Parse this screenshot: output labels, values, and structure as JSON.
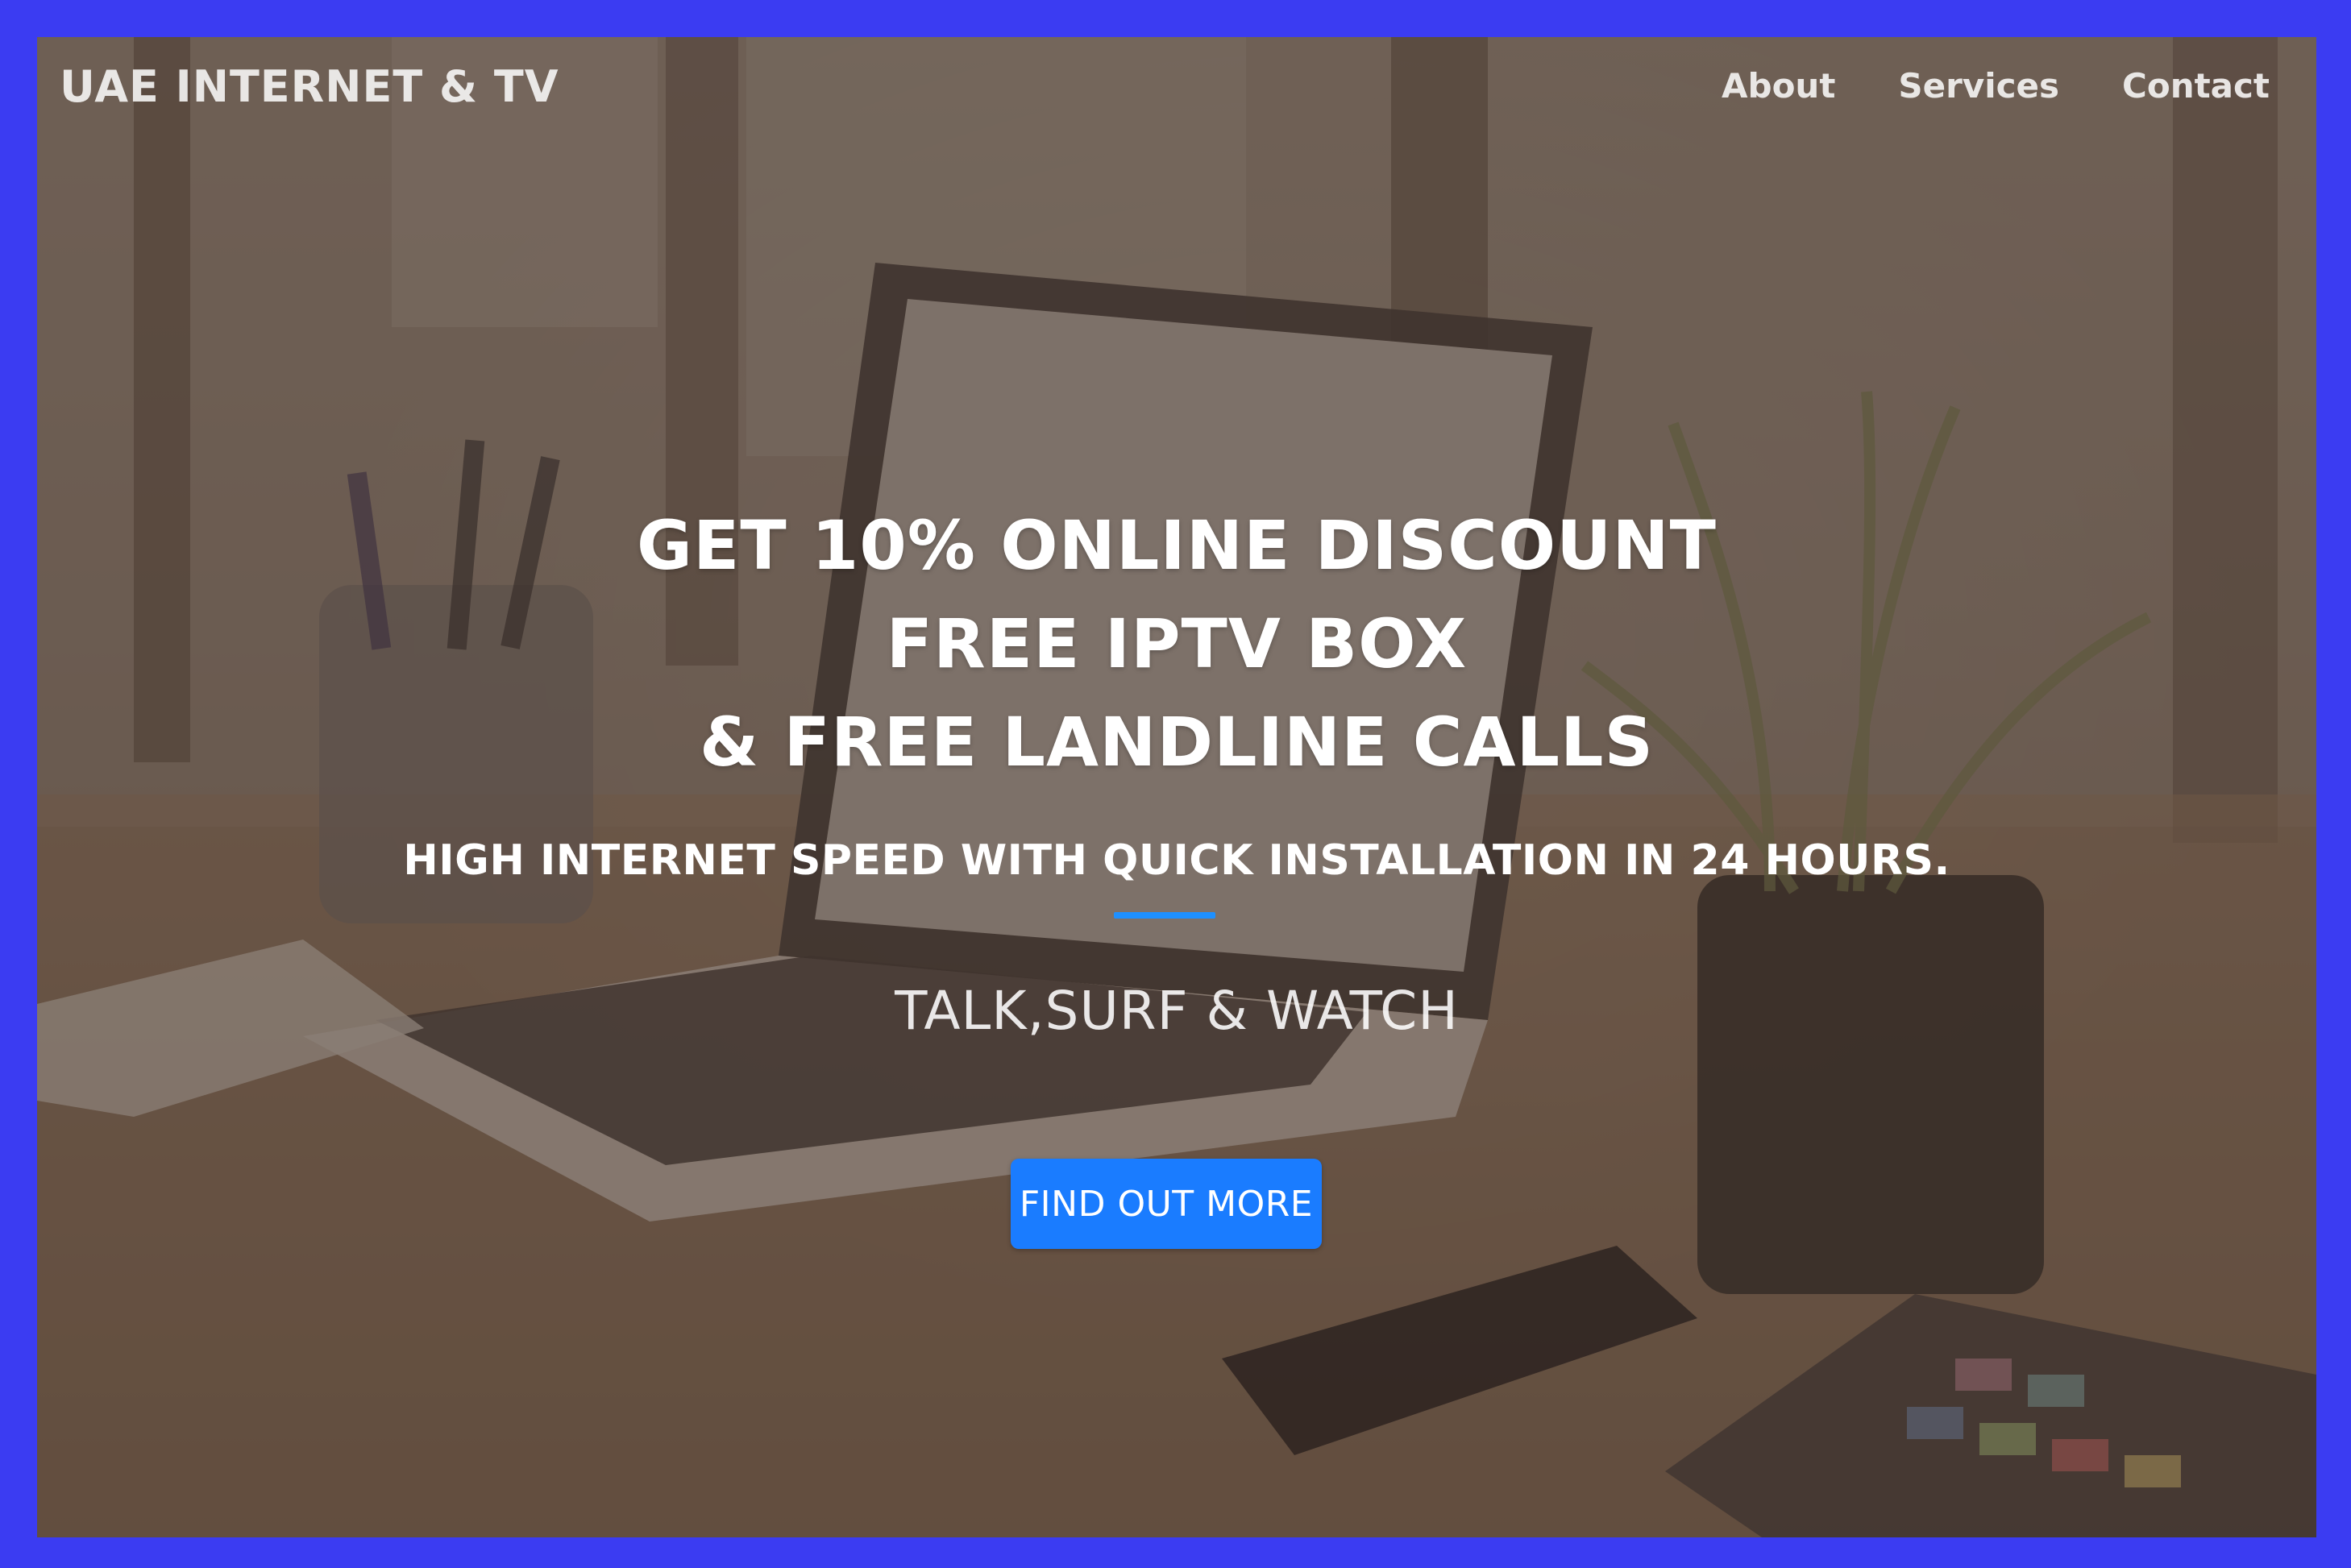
{
  "navbar": {
    "brand": "UAE INTERNET & TV",
    "links": [
      "About",
      "Services",
      "Contact"
    ]
  },
  "hero": {
    "headline_lines": [
      "GET 10% ONLINE DISCOUNT",
      "FREE IPTV BOX",
      "& FREE LANDLINE CALLS"
    ],
    "subheadline": "HIGH INTERNET SPEED WITH QUICK INSTALLATION IN 24 HOURS.",
    "tagline": "TALK,SURF & WATCH",
    "cta_label": "FIND OUT MORE"
  },
  "colors": {
    "frame": "#3b3cf2",
    "accent": "#1e90ff",
    "button": "#1a7cff"
  }
}
